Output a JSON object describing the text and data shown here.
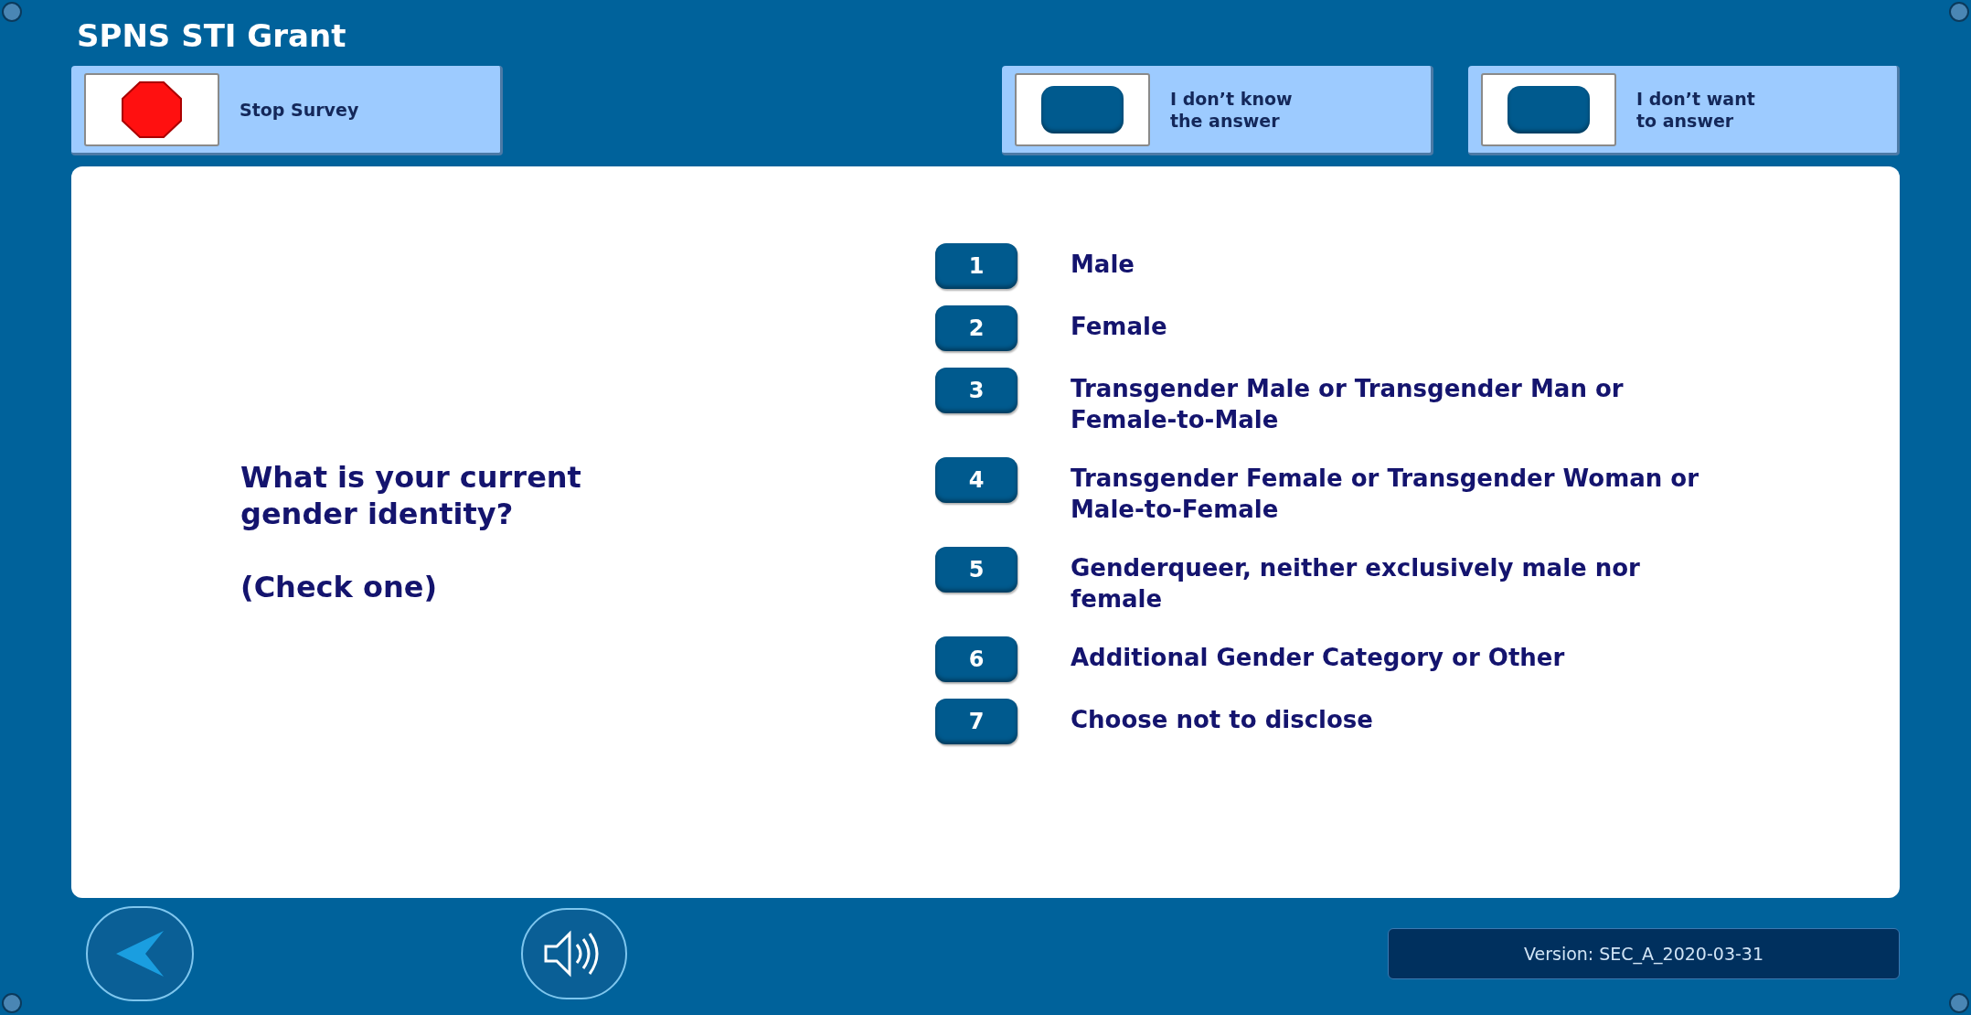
{
  "window": {
    "title": "SPNS STI Grant"
  },
  "toolbar": {
    "stop": "Stop Survey",
    "dont_know": "I don’t know\nthe answer",
    "dont_want": "I don’t want\nto answer"
  },
  "question": {
    "text": "What is your current\ngender identity?",
    "instruction": "(Check one)"
  },
  "options": [
    {
      "number": "1",
      "label": "Male"
    },
    {
      "number": "2",
      "label": "Female"
    },
    {
      "number": "3",
      "label": "Transgender Male or Transgender Man or\nFemale-to-Male"
    },
    {
      "number": "4",
      "label": "Transgender Female or Transgender Woman or\nMale-to-Female"
    },
    {
      "number": "5",
      "label": "Genderqueer, neither exclusively male nor\nfemale"
    },
    {
      "number": "6",
      "label": "Additional Gender Category or Other"
    },
    {
      "number": "7",
      "label": "Choose not to disclose"
    }
  ],
  "footer": {
    "version": "Version: SEC_A_2020-03-31"
  }
}
